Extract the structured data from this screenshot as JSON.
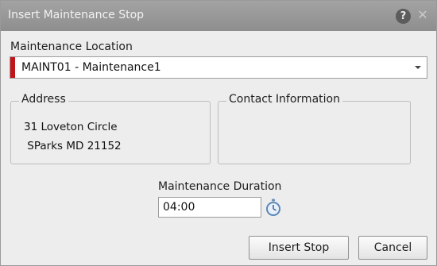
{
  "window": {
    "title": "Insert Maintenance Stop",
    "help_glyph": "?",
    "close_glyph": "✕"
  },
  "location": {
    "label": "Maintenance Location",
    "selected_value": "MAINT01 - Maintenance1",
    "required_marker_color": "#c0151b"
  },
  "address": {
    "legend": "Address",
    "line1": "31 Loveton Circle",
    "line2": " SParks MD 21152"
  },
  "contact": {
    "legend": "Contact Information"
  },
  "duration": {
    "label": "Maintenance Duration",
    "value": "04:00",
    "icon": "stopwatch-icon"
  },
  "buttons": {
    "insert_label": "Insert Stop",
    "cancel_label": "Cancel"
  }
}
